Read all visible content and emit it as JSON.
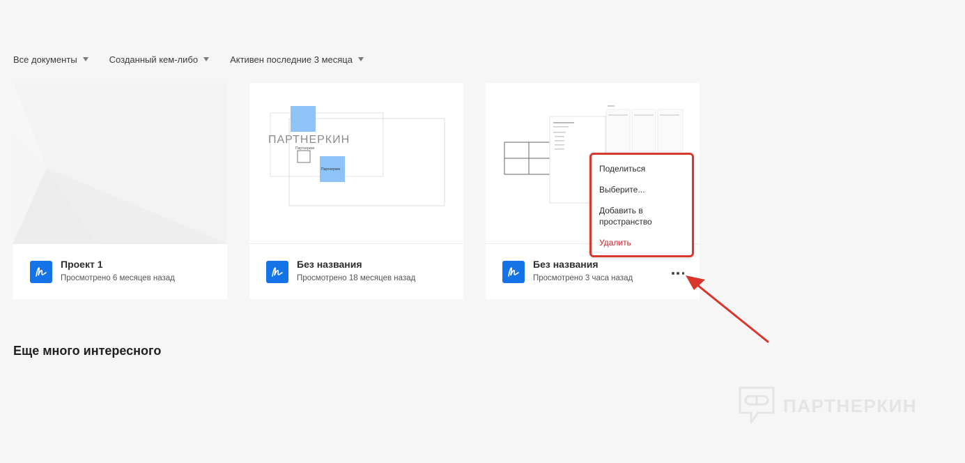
{
  "filters": [
    {
      "label": "Все документы"
    },
    {
      "label": "Созданный кем-либо"
    },
    {
      "label": "Активен последние 3 месяца"
    }
  ],
  "cards": [
    {
      "title": "Проект 1",
      "subtitle": "Просмотрено 6 месяцев назад"
    },
    {
      "title": "Без названия",
      "subtitle": "Просмотрено 18 месяцев назад",
      "thumb_text": "ПАРТНЕРКИН",
      "thumb_small_label": "Партнеркин",
      "thumb_note_label": "Партнеркин"
    },
    {
      "title": "Без названия",
      "subtitle": "Просмотрено 3 часа назад"
    }
  ],
  "context_menu": {
    "items": [
      {
        "label": "Поделиться"
      },
      {
        "label": "Выберите..."
      },
      {
        "label": "Добавить в пространство"
      },
      {
        "label": "Удалить"
      }
    ],
    "border_color": "#d63a2f",
    "danger_color": "#c9252c"
  },
  "section": {
    "title": "Еще много интересного"
  },
  "watermark": {
    "text": "ПАРТНЕРКИН"
  },
  "colors": {
    "background": "#f6f6f6",
    "app_icon": "#1473e6",
    "sticky_note": "#8fc2f7",
    "arrow": "#d9352b"
  },
  "icons": {
    "app": "signature-icon",
    "more": "more-horizontal-icon",
    "filter_caret": "caret-down-icon",
    "watermark": "chat-bubble-logo-icon"
  }
}
